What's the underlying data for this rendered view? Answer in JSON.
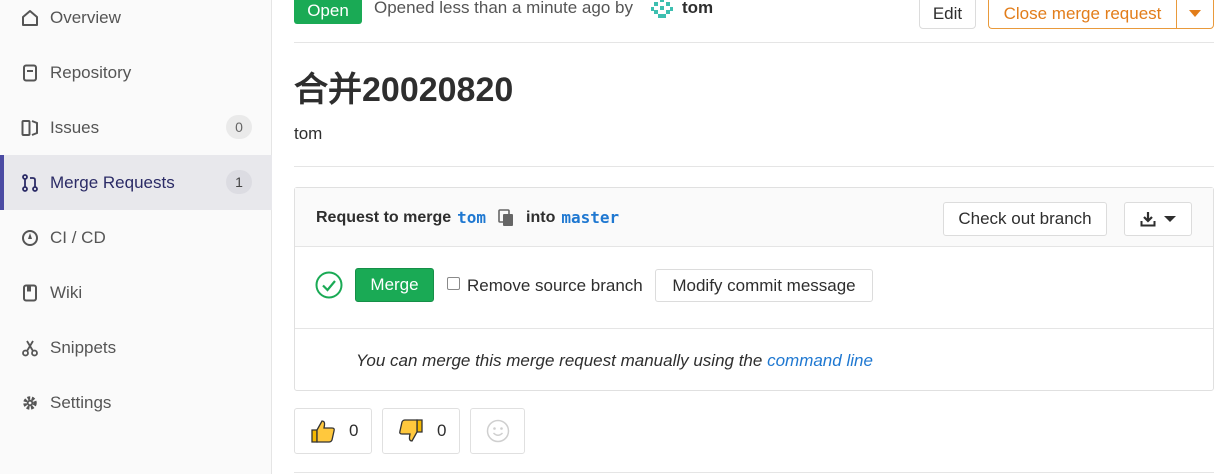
{
  "sidebar": {
    "items": [
      {
        "label": "Overview",
        "icon": "home-icon"
      },
      {
        "label": "Repository",
        "icon": "repository-icon"
      },
      {
        "label": "Issues",
        "icon": "issues-icon",
        "count": "0"
      },
      {
        "label": "Merge Requests",
        "icon": "merge-request-icon",
        "count": "1",
        "active": true
      },
      {
        "label": "CI / CD",
        "icon": "rocket-icon"
      },
      {
        "label": "Wiki",
        "icon": "book-icon"
      },
      {
        "label": "Snippets",
        "icon": "scissors-icon"
      },
      {
        "label": "Settings",
        "icon": "gear-icon"
      }
    ]
  },
  "header": {
    "status": "Open",
    "opened_text": "Opened less than a minute ago by",
    "author": "tom",
    "edit_label": "Edit",
    "close_label": "Close merge request"
  },
  "mr": {
    "title": "合并20020820",
    "description": "tom"
  },
  "widget": {
    "request_prefix": "Request to merge",
    "source_branch": "tom",
    "into": "into",
    "target_branch": "master",
    "checkout_label": "Check out branch",
    "merge_label": "Merge",
    "remove_source_label": "Remove source branch",
    "modify_commit_label": "Modify commit message",
    "manual_text": "You can merge this merge request manually using the",
    "manual_link": "command line"
  },
  "awards": {
    "thumbsup_count": "0",
    "thumbsdown_count": "0"
  },
  "colors": {
    "success": "#1aaa55",
    "warning": "#e27d1a",
    "link": "#1f78d1",
    "active_nav": "#4b4ba3"
  }
}
